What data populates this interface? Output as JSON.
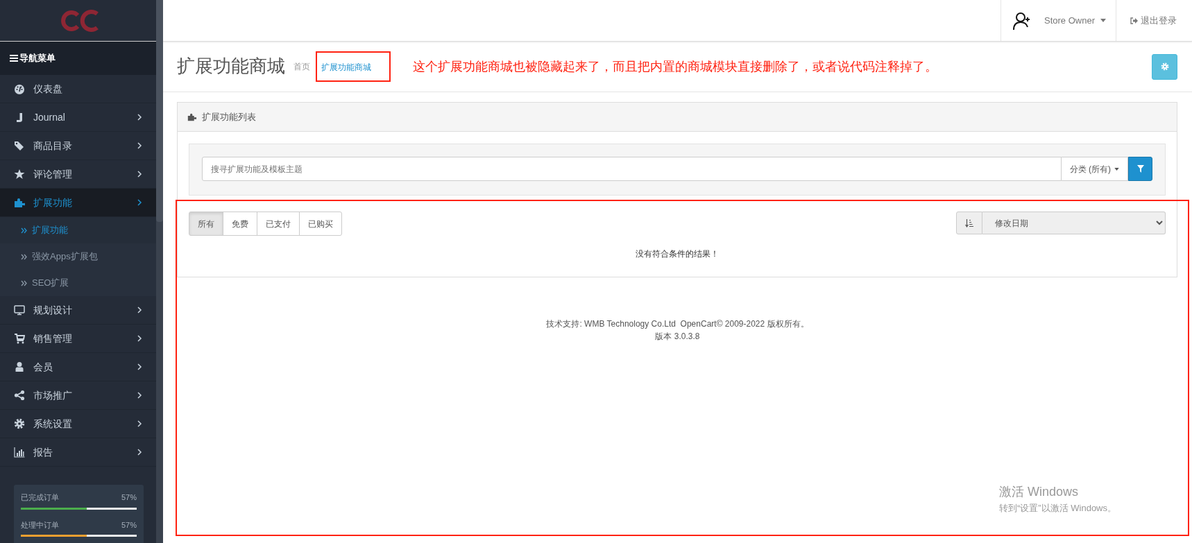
{
  "header": {
    "user": "Store Owner",
    "logout": "退出登录"
  },
  "sidebar": {
    "title": "导航菜单",
    "items": [
      {
        "label": "仪表盘",
        "has_submenu": false,
        "selected": false
      },
      {
        "label": "Journal",
        "has_submenu": true,
        "selected": false
      },
      {
        "label": "商品目录",
        "has_submenu": true,
        "selected": false
      },
      {
        "label": "评论管理",
        "has_submenu": true,
        "selected": false
      },
      {
        "label": "扩展功能",
        "has_submenu": true,
        "selected": true,
        "children": [
          {
            "label": "扩展功能",
            "selected": true
          },
          {
            "label": "强效Apps扩展包",
            "selected": false
          },
          {
            "label": "SEO扩展",
            "selected": false
          }
        ]
      },
      {
        "label": "规划设计",
        "has_submenu": true,
        "selected": false
      },
      {
        "label": "销售管理",
        "has_submenu": true,
        "selected": false
      },
      {
        "label": "会员",
        "has_submenu": true,
        "selected": false
      },
      {
        "label": "市场推广",
        "has_submenu": true,
        "selected": false
      },
      {
        "label": "系统设置",
        "has_submenu": true,
        "selected": false
      },
      {
        "label": "报告",
        "has_submenu": true,
        "selected": false
      }
    ],
    "progress": [
      {
        "label": "已完成订单",
        "reading": "57%",
        "level": 0.57,
        "color": "#4cae4c"
      },
      {
        "label": "处理中订单",
        "reading": "57%",
        "level": 0.57,
        "color": "#f0a030"
      }
    ]
  },
  "page": {
    "title": "扩展功能商城",
    "breadcrumbs": [
      {
        "label": "首页",
        "selected": false
      },
      {
        "label": "扩展功能商城",
        "selected": true
      }
    ]
  },
  "annotation": {
    "text": "这个扩展功能商城也被隐藏起来了，而且把内置的商城模块直接删除了，或者说代码注释掉了。"
  },
  "panel": {
    "title": "扩展功能列表",
    "search": {
      "placeholder": "搜寻扩展功能及模板主题"
    },
    "category_button": "分类 (所有)",
    "tabs": [
      {
        "label": "所有",
        "selected": true
      },
      {
        "label": "免费",
        "selected": false
      },
      {
        "label": "已支付",
        "selected": false
      },
      {
        "label": "已购买",
        "selected": false
      }
    ],
    "sort": {
      "value": "修改日期"
    },
    "empty_message": "没有符合条件的结果！"
  },
  "footer": {
    "credit": "技术支持: WMB Technology Co.Ltd  OpenCart© 2009-2022 版权所有。",
    "version": "版本 3.0.3.8"
  },
  "windows_notice": {
    "title": "激活 Windows",
    "subtitle": "转到“设置”以激活 Windows。"
  }
}
